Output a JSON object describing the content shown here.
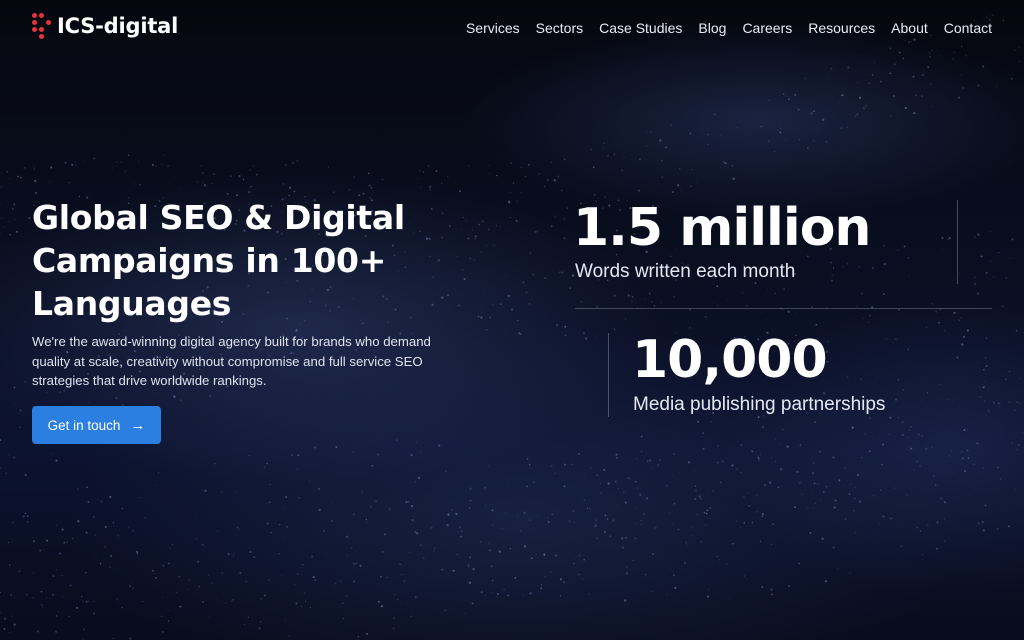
{
  "brand": {
    "name": "ICS-digital",
    "accent_color": "#e8323c",
    "logo_icon": "dot-grid-logo-icon"
  },
  "nav": {
    "items": [
      "Services",
      "Sectors",
      "Case Studies",
      "Blog",
      "Careers",
      "Resources",
      "About",
      "Contact"
    ]
  },
  "hero": {
    "title": "Global SEO & Digital Campaigns in 100+ Languages",
    "description": "We're the award-winning digital agency built for brands who demand quality at scale, creativity without compromise and full service SEO strategies that drive worldwide rankings.",
    "cta_label": "Get in touch",
    "cta_icon": "arrow-right-icon",
    "cta_color": "#2a7fe0"
  },
  "stats": [
    {
      "value": "1.5 million",
      "label": "Words written each month"
    },
    {
      "value": "10,000",
      "label": "Media publishing partnerships"
    }
  ],
  "colors": {
    "background": "#070a16"
  }
}
